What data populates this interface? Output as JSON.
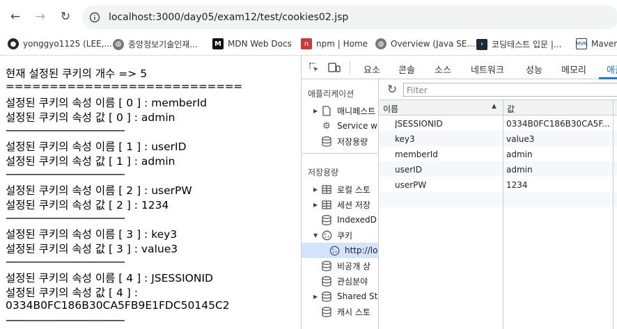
{
  "browser": {
    "url": "localhost:3000/day05/exam12/test/cookies02.jsp",
    "bookmarks": [
      {
        "label": "yonggyo1125 (LEE,...",
        "icon": "github-icon"
      },
      {
        "label": "중앙정보기술인재...",
        "icon": "globe-icon"
      },
      {
        "label": "MDN Web Docs",
        "icon": "mdn-icon"
      },
      {
        "label": "npm | Home",
        "icon": "npm-icon"
      },
      {
        "label": "Overview (Java SE...",
        "icon": "globe-icon"
      },
      {
        "label": "코딩테스트 입문 |...",
        "icon": "programmers-icon"
      },
      {
        "label": "Maven",
        "icon": "maven-icon"
      }
    ]
  },
  "page": {
    "lines": [
      "현재 설정된 쿠키의 개수 => 5",
      "===========================",
      "설정된 쿠키의 속성 이름 [ 0 ] : memberId",
      "설정된 쿠키의 속성 값 [ 0 ] : admin",
      "--------------------------------------------------",
      "설정된 쿠키의 속성 이름 [ 1 ] : userID",
      "설정된 쿠키의 속성 값 [ 1 ] : admin",
      "--------------------------------------------------",
      "설정된 쿠키의 속성 이름 [ 2 ] : userPW",
      "설정된 쿠키의 속성 값 [ 2 ] : 1234",
      "--------------------------------------------------",
      "설정된 쿠키의 속성 이름 [ 3 ] : key3",
      "설정된 쿠키의 속성 값 [ 3 ] : value3",
      "--------------------------------------------------",
      "설정된 쿠키의 속성 이름 [ 4 ] : JSESSIONID",
      "설정된 쿠키의 속성 값 [ 4 ] :",
      "0334B0FC186B30CA5FB9E1FDC50145C2",
      "--------------------------------------------------"
    ]
  },
  "devtools": {
    "tabs": [
      "요소",
      "콘솔",
      "소스",
      "네트워크",
      "성능",
      "메모리",
      "애플"
    ],
    "active_tab": "애플",
    "sections": {
      "app_title": "애플리케이션",
      "app_items": [
        "매니페스트",
        "Service w",
        "저장용량"
      ],
      "storage_title": "저장용량",
      "storage_items": [
        "로컬 스토",
        "세션 저장",
        "IndexedD",
        "쿠키",
        "http://lo",
        "비공개 상",
        "관심분야",
        "Shared St",
        "캐시 스토"
      ]
    },
    "filter_placeholder": "Filter",
    "columns": [
      "이름",
      "값"
    ],
    "rows": [
      {
        "name": "JSESSIONID",
        "value": "0334B0FC186B30CA5F..."
      },
      {
        "name": "key3",
        "value": "value3"
      },
      {
        "name": "memberId",
        "value": "admin"
      },
      {
        "name": "userID",
        "value": "admin"
      },
      {
        "name": "userPW",
        "value": "1234"
      }
    ]
  }
}
